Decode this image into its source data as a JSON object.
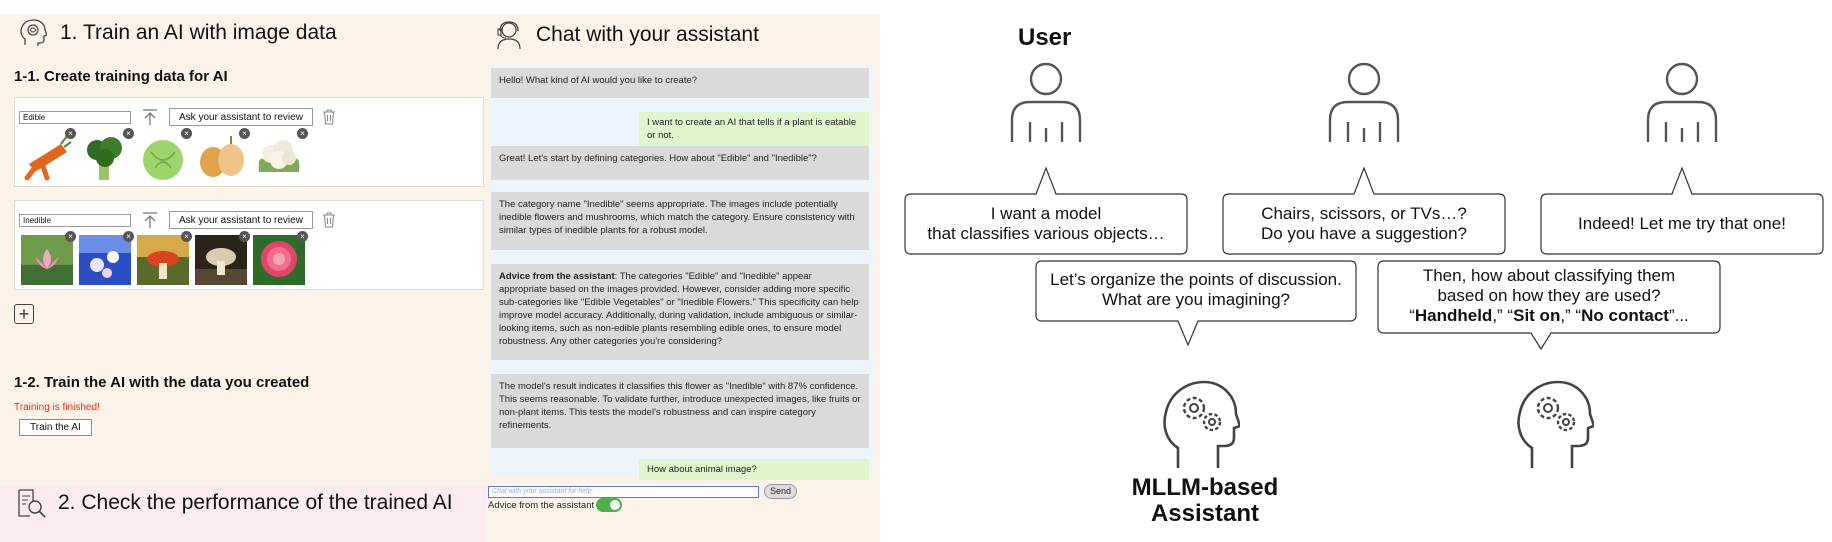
{
  "left": {
    "section1_title": "1. Train an AI with image data",
    "sub1_title": "1-1. Create training data for AI",
    "categories": [
      {
        "name": "Edible",
        "review_label": "Ask your assistant to review"
      },
      {
        "name": "Inedible",
        "review_label": "Ask your assistant to review"
      }
    ],
    "remove_symbol": "×",
    "add_symbol": "+",
    "sub2_title": "1-2. Train the AI with the data you created",
    "training_status": "Training is finished!",
    "train_button": "Train the AI",
    "section2_title": "2. Check the performance of the trained AI",
    "colors": {
      "panel_bg": "#fbf3e8",
      "section2_bg": "#fcecf1",
      "status_red": "#e0301e"
    }
  },
  "chat": {
    "title": "Chat with your assistant",
    "messages": [
      {
        "role": "assistant",
        "text": "Hello! What kind of AI would you like to create?"
      },
      {
        "role": "user",
        "text": "I want to create an AI that tells if a plant is eatable or not."
      },
      {
        "role": "assistant",
        "text": "Great! Let's start by defining categories. How about \"Edible\" and \"Inedible\"?"
      },
      {
        "role": "assistant",
        "text": "The category name \"Inedible\" seems appropriate. The images include potentially inedible flowers and mushrooms, which match the category. Ensure consistency with similar types of inedible plants for a robust model."
      },
      {
        "role": "assistant",
        "prefix": "Advice from the assistant",
        "text": ": The categories \"Edible\" and \"Inedible\" appear appropriate based on the images provided. However, consider adding more specific sub-categories like \"Edible Vegetables\" or \"Inedible Flowers.\" This specificity can help improve model accuracy. Additionally, during validation, include ambiguous or similar-looking items, such as non-edible plants resembling edible ones, to ensure model robustness. Any other categories you're considering?"
      },
      {
        "role": "assistant",
        "text": "The model's result indicates it classifies this flower as \"Inedible\" with 87% confidence. This seems reasonable. To validate further, introduce unexpected images, like fruits or non-plant items. This tests the model's robustness and can inspire category refinements."
      },
      {
        "role": "user",
        "text": "How about animal image?"
      }
    ],
    "input_placeholder": "Chat with your assistant for help.",
    "send_label": "Send",
    "advice_toggle_label": "Advice from the assistant",
    "advice_toggle_on": true,
    "colors": {
      "assistant_bubble": "#dadada",
      "user_bubble": "#dff5cc",
      "toggle_on": "#4cb04c"
    }
  },
  "diagram": {
    "user_label": "User",
    "assistant_label_line1": "MLLM-based",
    "assistant_label_line2": "Assistant",
    "user_bubbles": [
      {
        "line1": "I want a model",
        "line2": "that classifies various objects…"
      },
      {
        "line1": "Chairs, scissors, or TVs…?",
        "line2": "Do you have a suggestion?"
      },
      {
        "line1": "Indeed! Let me try that one!"
      }
    ],
    "assistant_bubbles": [
      {
        "line1": "Let’s organize the points of discussion.",
        "line2": "What are you imagining?"
      },
      {
        "line1": "Then, how about classifying them",
        "line2": "based on how they are used?",
        "line3_parts": [
          "“",
          "Handheld",
          ",” “",
          "Sit on",
          ",” “",
          "No contact",
          "”..."
        ]
      }
    ]
  }
}
